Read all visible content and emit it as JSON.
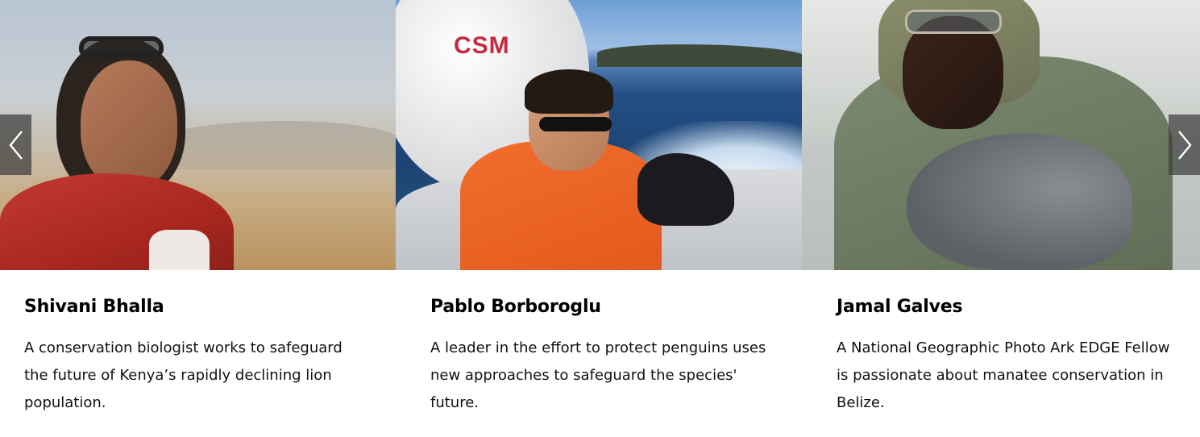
{
  "carousel": {
    "cards": [
      {
        "name": "Shivani Bhalla",
        "description": "A conservation biologist works to safeguard the future of Kenya’s rapidly declining lion population.",
        "photo_icon": "person-savanna-photo"
      },
      {
        "name": "Pablo Borboroglu",
        "description": "A leader in the effort to protect penguins uses new approaches to safeguard the species' future.",
        "photo_icon": "person-boat-photo",
        "photo_text": "CSM"
      },
      {
        "name": "Jamal Galves",
        "description": "A National Geographic Photo Ark EDGE Fellow is passionate about manatee conservation in Belize.",
        "photo_icon": "person-manatee-photo"
      }
    ],
    "nav": {
      "prev_icon": "chevron-left-icon",
      "next_icon": "chevron-right-icon"
    }
  },
  "colors": {
    "nav_background": "#3c3c3c",
    "text": "#000000",
    "csm_red": "#c52a3f"
  }
}
